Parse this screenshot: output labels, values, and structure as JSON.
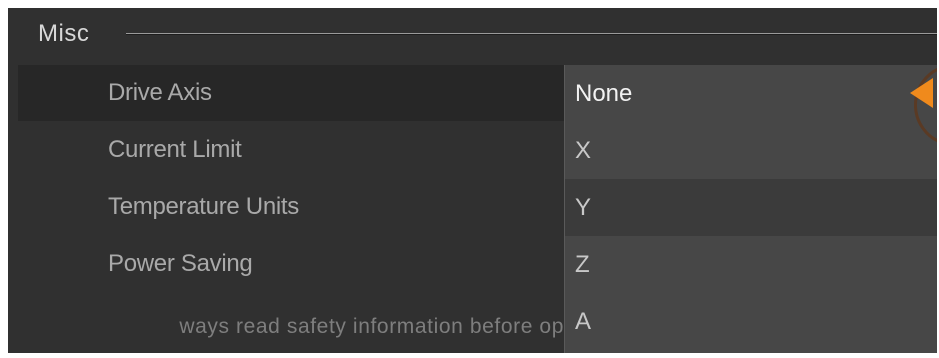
{
  "section": {
    "title": "Misc"
  },
  "settings": {
    "rows": [
      {
        "label": "Drive Axis"
      },
      {
        "label": "Current Limit"
      },
      {
        "label": "Temperature Units"
      },
      {
        "label": "Power Saving"
      }
    ]
  },
  "footer": {
    "tip": "ways read safety information before op"
  },
  "dropdown": {
    "selected": "None",
    "options": [
      "None",
      "X",
      "Y",
      "Z",
      "A"
    ],
    "hovered_option": "Y",
    "open_icon": "triangle-left-icon"
  },
  "colors": {
    "background": "#303030",
    "dropdown_bg": "#474747",
    "accent": "#f08a1c",
    "label_text": "#a9a9a9"
  }
}
